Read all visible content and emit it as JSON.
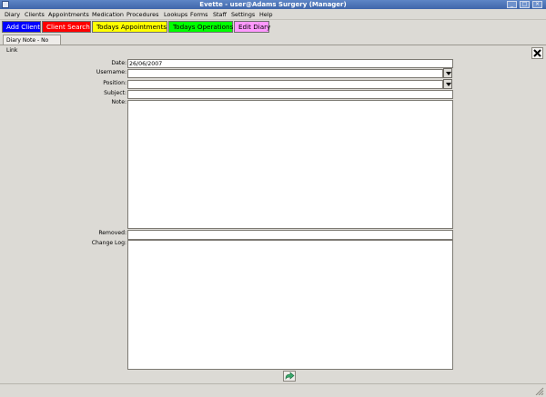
{
  "window": {
    "title": "Evette - user@Adams Surgery (Manager)"
  },
  "menu": [
    "Diary",
    "Clients",
    "Appointments",
    "Medication",
    "Procedures",
    "Lookups",
    "Forms",
    "Staff",
    "Settings",
    "Help"
  ],
  "toolbar": {
    "add_client": "Add Client",
    "client_search": "Client Search",
    "todays_appointments": "Todays Appointments",
    "todays_operations": "Todays Operations",
    "edit_diary": "Edit Diary"
  },
  "colors": {
    "add_client": "#0000ff",
    "client_search": "#ff0000",
    "todays_appointments": "#ffff00",
    "todays_operations": "#00ff00",
    "edit_diary": "#ff99ff"
  },
  "tab": {
    "label": "Diary Note - No Link"
  },
  "form": {
    "date_label": "Date:",
    "date_value": "26/06/2007",
    "username_label": "Username:",
    "position_label": "Position:",
    "subject_label": "Subject:",
    "note_label": "Note:",
    "removed_label": "Removed:",
    "changelog_label": "Change Log:"
  }
}
